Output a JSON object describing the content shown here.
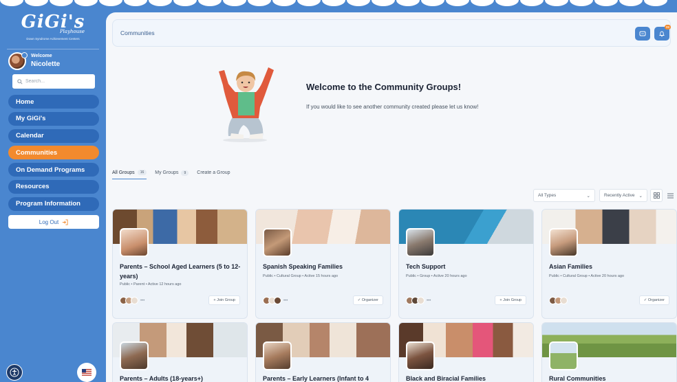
{
  "sidebar": {
    "logo": {
      "brand": "GiGi's",
      "brand_sub": "Playhouse",
      "tagline": "Down Syndrome Achievement Centers"
    },
    "user": {
      "welcome": "Welcome",
      "name": "Nicolette"
    },
    "search_placeholder": "Search...",
    "nav": [
      {
        "label": "Home",
        "active": false
      },
      {
        "label": "My GiGi's",
        "active": false
      },
      {
        "label": "Calendar",
        "active": false
      },
      {
        "label": "Communities",
        "active": true
      },
      {
        "label": "On Demand Programs",
        "active": false
      },
      {
        "label": "Resources",
        "active": false
      },
      {
        "label": "Program Information",
        "active": false
      }
    ],
    "logout": "Log Out"
  },
  "header": {
    "title": "Communities",
    "notifications": "99"
  },
  "hero": {
    "title": "Welcome to the Community Groups!",
    "subtitle": "If you would like to see another community created please let us know!"
  },
  "tabs": [
    {
      "label": "All Groups",
      "count": "16",
      "active": true
    },
    {
      "label": "My Groups",
      "count": "9",
      "active": false
    },
    {
      "label": "Create a Group",
      "count": null,
      "active": false
    }
  ],
  "filters": {
    "type": "All Types",
    "sort": "Recently Active"
  },
  "groups": [
    {
      "name": "Parents – School Aged Learners (5 to 12-years)",
      "meta": "Public  •  Parent  •  Active 12 hours ago",
      "action": "+ Join Group"
    },
    {
      "name": "Spanish Speaking Families",
      "meta": "Public  •  Cultural Group  •  Active 15 hours ago",
      "action": "✓ Organizer"
    },
    {
      "name": "Tech Support",
      "meta": "Public  •  Group  •  Active 20 hours ago",
      "action": "+ Join Group"
    },
    {
      "name": "Asian Families",
      "meta": "Public  •  Cultural Group  •  Active 20 hours ago",
      "action": "✓ Organizer"
    },
    {
      "name": "Parents – Adults (18-years+)"
    },
    {
      "name": "Parents – Early Learners (Infant to 4"
    },
    {
      "name": "Black and Biracial Families"
    },
    {
      "name": "Rural Communities"
    }
  ],
  "colors": {
    "brand_blue": "#4a86cf",
    "nav_blue": "#2f6ab8",
    "accent_orange": "#f28a2e"
  }
}
